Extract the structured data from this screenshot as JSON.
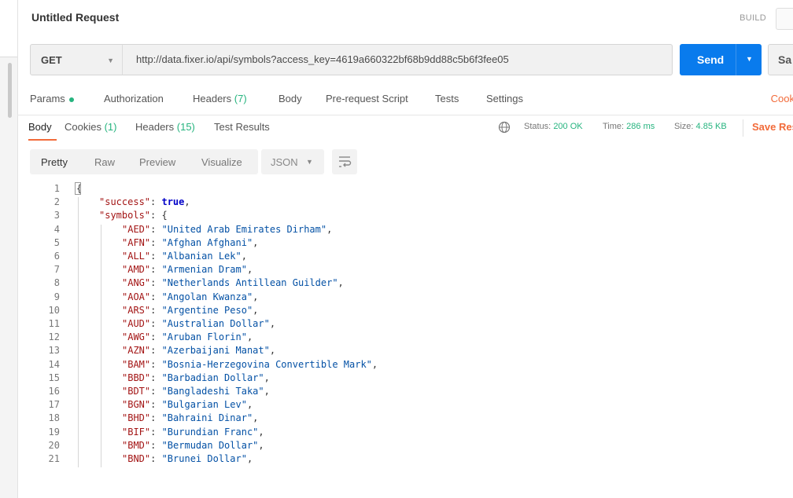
{
  "window": {
    "title": "Untitled Request",
    "build_label": "BUILD"
  },
  "request": {
    "method": "GET",
    "url": "http://data.fixer.io/api/symbols?access_key=4619a660322bf68b9dd88c5b6f3fee05",
    "send_label": "Send",
    "save_label": "Sa"
  },
  "request_tabs": {
    "params": "Params",
    "authorization": "Authorization",
    "headers": "Headers",
    "headers_count": "(7)",
    "body": "Body",
    "pre_request_script": "Pre-request Script",
    "tests": "Tests",
    "settings": "Settings",
    "cookies": "Cook"
  },
  "response_tabs": {
    "body": "Body",
    "cookies": "Cookies",
    "cookies_count": "(1)",
    "headers": "Headers",
    "headers_count": "(15)",
    "test_results": "Test Results"
  },
  "response_meta": {
    "status_label": "Status:",
    "status_value": "200 OK",
    "time_label": "Time:",
    "time_value": "286 ms",
    "size_label": "Size:",
    "size_value": "4.85 KB",
    "save_response": "Save Res"
  },
  "view": {
    "pretty": "Pretty",
    "raw": "Raw",
    "preview": "Preview",
    "visualize": "Visualize",
    "format": "JSON"
  },
  "code_lines": [
    {
      "n": "1",
      "indent": 0,
      "text": "{"
    },
    {
      "n": "2",
      "indent": 1,
      "key": "\"success\"",
      "bool": "true",
      "trail": ","
    },
    {
      "n": "3",
      "indent": 1,
      "key": "\"symbols\"",
      "trail": " {"
    },
    {
      "n": "4",
      "indent": 2,
      "key": "\"AED\"",
      "str": "\"United Arab Emirates Dirham\"",
      "trail": ","
    },
    {
      "n": "5",
      "indent": 2,
      "key": "\"AFN\"",
      "str": "\"Afghan Afghani\"",
      "trail": ","
    },
    {
      "n": "6",
      "indent": 2,
      "key": "\"ALL\"",
      "str": "\"Albanian Lek\"",
      "trail": ","
    },
    {
      "n": "7",
      "indent": 2,
      "key": "\"AMD\"",
      "str": "\"Armenian Dram\"",
      "trail": ","
    },
    {
      "n": "8",
      "indent": 2,
      "key": "\"ANG\"",
      "str": "\"Netherlands Antillean Guilder\"",
      "trail": ","
    },
    {
      "n": "9",
      "indent": 2,
      "key": "\"AOA\"",
      "str": "\"Angolan Kwanza\"",
      "trail": ","
    },
    {
      "n": "10",
      "indent": 2,
      "key": "\"ARS\"",
      "str": "\"Argentine Peso\"",
      "trail": ","
    },
    {
      "n": "11",
      "indent": 2,
      "key": "\"AUD\"",
      "str": "\"Australian Dollar\"",
      "trail": ","
    },
    {
      "n": "12",
      "indent": 2,
      "key": "\"AWG\"",
      "str": "\"Aruban Florin\"",
      "trail": ","
    },
    {
      "n": "13",
      "indent": 2,
      "key": "\"AZN\"",
      "str": "\"Azerbaijani Manat\"",
      "trail": ","
    },
    {
      "n": "14",
      "indent": 2,
      "key": "\"BAM\"",
      "str": "\"Bosnia-Herzegovina Convertible Mark\"",
      "trail": ","
    },
    {
      "n": "15",
      "indent": 2,
      "key": "\"BBD\"",
      "str": "\"Barbadian Dollar\"",
      "trail": ","
    },
    {
      "n": "16",
      "indent": 2,
      "key": "\"BDT\"",
      "str": "\"Bangladeshi Taka\"",
      "trail": ","
    },
    {
      "n": "17",
      "indent": 2,
      "key": "\"BGN\"",
      "str": "\"Bulgarian Lev\"",
      "trail": ","
    },
    {
      "n": "18",
      "indent": 2,
      "key": "\"BHD\"",
      "str": "\"Bahraini Dinar\"",
      "trail": ","
    },
    {
      "n": "19",
      "indent": 2,
      "key": "\"BIF\"",
      "str": "\"Burundian Franc\"",
      "trail": ","
    },
    {
      "n": "20",
      "indent": 2,
      "key": "\"BMD\"",
      "str": "\"Bermudan Dollar\"",
      "trail": ","
    },
    {
      "n": "21",
      "indent": 2,
      "key": "\"BND\"",
      "str": "\"Brunei Dollar\"",
      "trail": ","
    }
  ]
}
